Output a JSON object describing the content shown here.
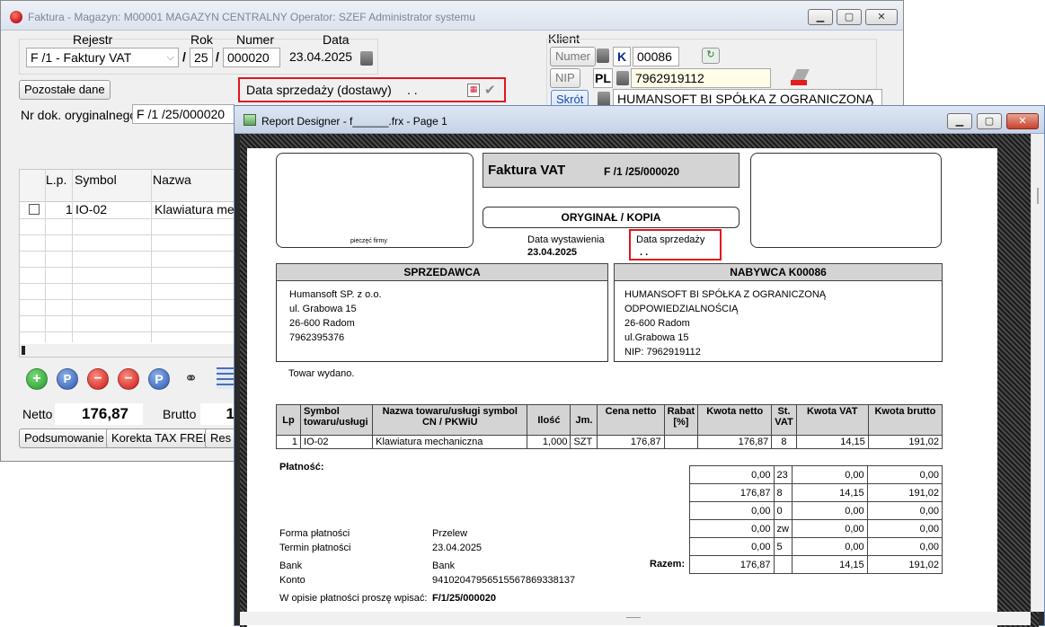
{
  "back_window": {
    "title": "Faktura - Magazyn: M00001 MAGAZYN CENTRALNY  Operator: SZEF Administrator systemu",
    "rejestr": {
      "label": "Rejestr",
      "value": "F /1  - Faktury VAT"
    },
    "rok": {
      "label": "Rok",
      "value": "25"
    },
    "numer": {
      "label": "Numer",
      "value": "000020"
    },
    "data": {
      "label": "Data",
      "value": "23.04.2025"
    },
    "slash": "/",
    "pozostale_button": "Pozostałe dane",
    "data_sprzedazy": {
      "label": "Data sprzedaży (dostawy)",
      "value": " .  ."
    },
    "nr_dok_label": "Nr dok. oryginalnego",
    "nr_dok_value": "F /1  /25/000020",
    "klient": {
      "label": "Klient",
      "numer_label": "Numer",
      "k_badge": "K",
      "numer_value": "00086",
      "nip_label": "NIP",
      "pl_badge": "PL",
      "nip_value": "7962919112",
      "skrot_label": "Skrót",
      "skrot_value": "HUMANSOFT BI SPÓŁKA Z OGRANICZONĄ"
    },
    "grid": {
      "headers": [
        "L.p.",
        "Symbol",
        "Nazwa"
      ],
      "row": {
        "lp": "1",
        "symbol": "IO-02",
        "nazwa": "Klawiatura mech"
      }
    },
    "netto_label": "Netto",
    "netto_value": "176,87",
    "brutto_label": "Brutto",
    "brutto_value": "1",
    "buttons": {
      "podsumowanie": "Podsumowanie",
      "korekta": "Korekta TAX FREE",
      "res": "Res"
    },
    "toolbar_icons": [
      "plus-icon",
      "p-magnify-icon",
      "minus-icon",
      "minus-check-icon",
      "p-icon",
      "binoculars-icon",
      "grid-icon"
    ]
  },
  "report_window": {
    "title": "Report Designer - f______.frx - Page 1",
    "page": {
      "doc_title": "Faktura VAT",
      "doc_number": "F /1  /25/000020",
      "pieczec": "pieczęć firmy",
      "oryginal": "ORYGINAŁ / KOPIA",
      "data_wystawienia_label": "Data wystawienia",
      "data_wystawienia_value": "23.04.2025",
      "data_sprzedazy_label": "Data sprzedaży",
      "data_sprzedazy_value": ". .",
      "sprzedawca": {
        "header": "SPRZEDAWCA",
        "lines": [
          "Humansoft SP. z o.o.",
          "ul. Grabowa 15",
          "26-600 Radom",
          "7962395376"
        ]
      },
      "nabywca": {
        "header": "NABYWCA  K00086",
        "lines": [
          "HUMANSOFT BI SPÓŁKA Z OGRANICZONĄ",
          "ODPOWIEDZIALNOŚCIĄ",
          "26-600   Radom",
          "ul.Grabowa 15",
          "NIP: 7962919112"
        ]
      },
      "towar_wydano": "Towar wydano.",
      "items_table": {
        "headers": [
          "Lp",
          "Symbol towaru/usługi",
          "Nazwa towaru/usługi symbol CN / PKWiU",
          "Ilość",
          "Jm.",
          "Cena netto",
          "Rabat [%]",
          "Kwota netto",
          "St. VAT",
          "Kwota VAT",
          "Kwota brutto"
        ],
        "rows": [
          [
            "1",
            "IO-02",
            "Klawiatura mechaniczna",
            "1,000",
            "SZT",
            "176,87",
            "",
            "176,87",
            "8",
            "14,15",
            "191,02"
          ]
        ]
      },
      "platnosc_label": "Płatność:",
      "summary_rows": [
        [
          "0,00",
          "23",
          "0,00",
          "0,00"
        ],
        [
          "176,87",
          "8",
          "14,15",
          "191,02"
        ],
        [
          "0,00",
          "0",
          "0,00",
          "0,00"
        ],
        [
          "0,00",
          "zw",
          "0,00",
          "0,00"
        ],
        [
          "0,00",
          "5",
          "0,00",
          "0,00"
        ]
      ],
      "razem_label": "Razem:",
      "razem_row": [
        "176,87",
        "",
        "14,15",
        "191,02"
      ],
      "payment": [
        {
          "label": "Forma płatności",
          "value": "Przelew"
        },
        {
          "label": "Termin płatności",
          "value": "23.04.2025"
        },
        {
          "label": "Bank",
          "value": "Bank"
        },
        {
          "label": "Konto",
          "value": "94102047956515567869338137"
        }
      ],
      "opis_label": "W opisie płatności proszę wpisać:",
      "opis_value": "F/1/25/000020"
    }
  }
}
